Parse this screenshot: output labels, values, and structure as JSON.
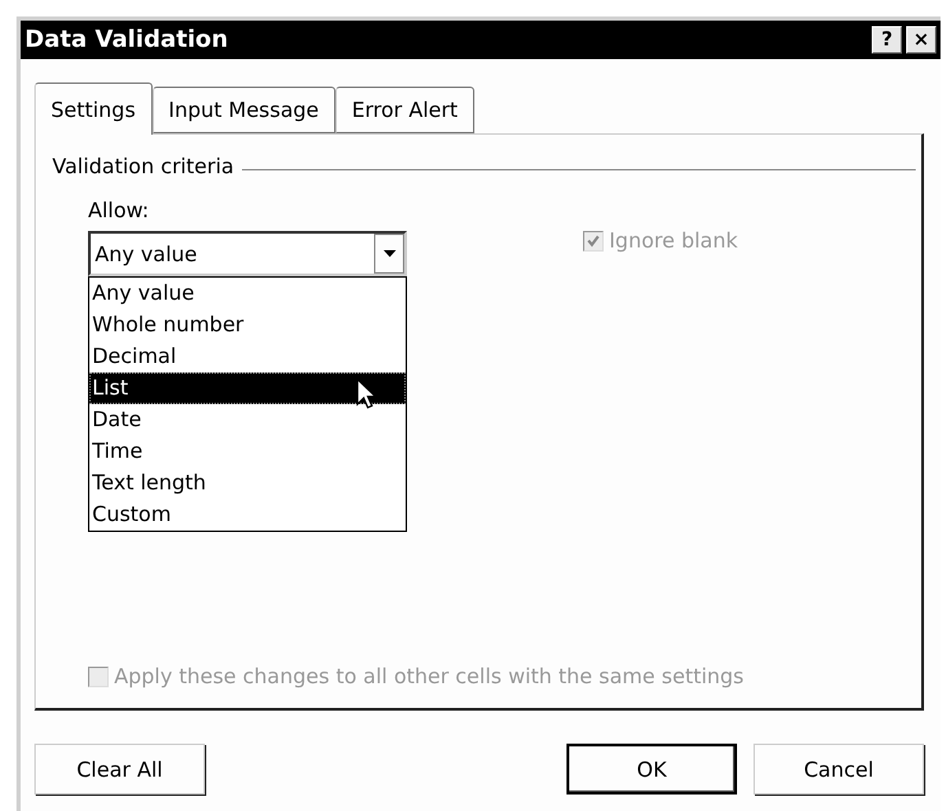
{
  "window": {
    "title": "Data Validation",
    "title_buttons": [
      "?",
      "×"
    ]
  },
  "tabs": [
    {
      "label": "Settings",
      "selected": true
    },
    {
      "label": "Input Message",
      "selected": false
    },
    {
      "label": "Error Alert",
      "selected": false
    }
  ],
  "section": {
    "title": "Validation criteria"
  },
  "allow": {
    "label": "Allow:",
    "value": "Any value",
    "options": [
      {
        "label": "Any value",
        "highlighted": false
      },
      {
        "label": "Whole number",
        "highlighted": false
      },
      {
        "label": "Decimal",
        "highlighted": false
      },
      {
        "label": "List",
        "highlighted": true
      },
      {
        "label": "Date",
        "highlighted": false
      },
      {
        "label": "Time",
        "highlighted": false
      },
      {
        "label": "Text length",
        "highlighted": false
      },
      {
        "label": "Custom",
        "highlighted": false
      }
    ]
  },
  "ignore_blank": {
    "label": "Ignore blank",
    "checked": true,
    "disabled": true
  },
  "apply_all": {
    "label": "Apply these changes to all other cells with the same settings",
    "checked": false,
    "disabled": true
  },
  "buttons": [
    {
      "label": "Clear All",
      "kind": "left"
    },
    {
      "label": "OK",
      "kind": "default"
    },
    {
      "label": "Cancel",
      "kind": "normal"
    }
  ]
}
